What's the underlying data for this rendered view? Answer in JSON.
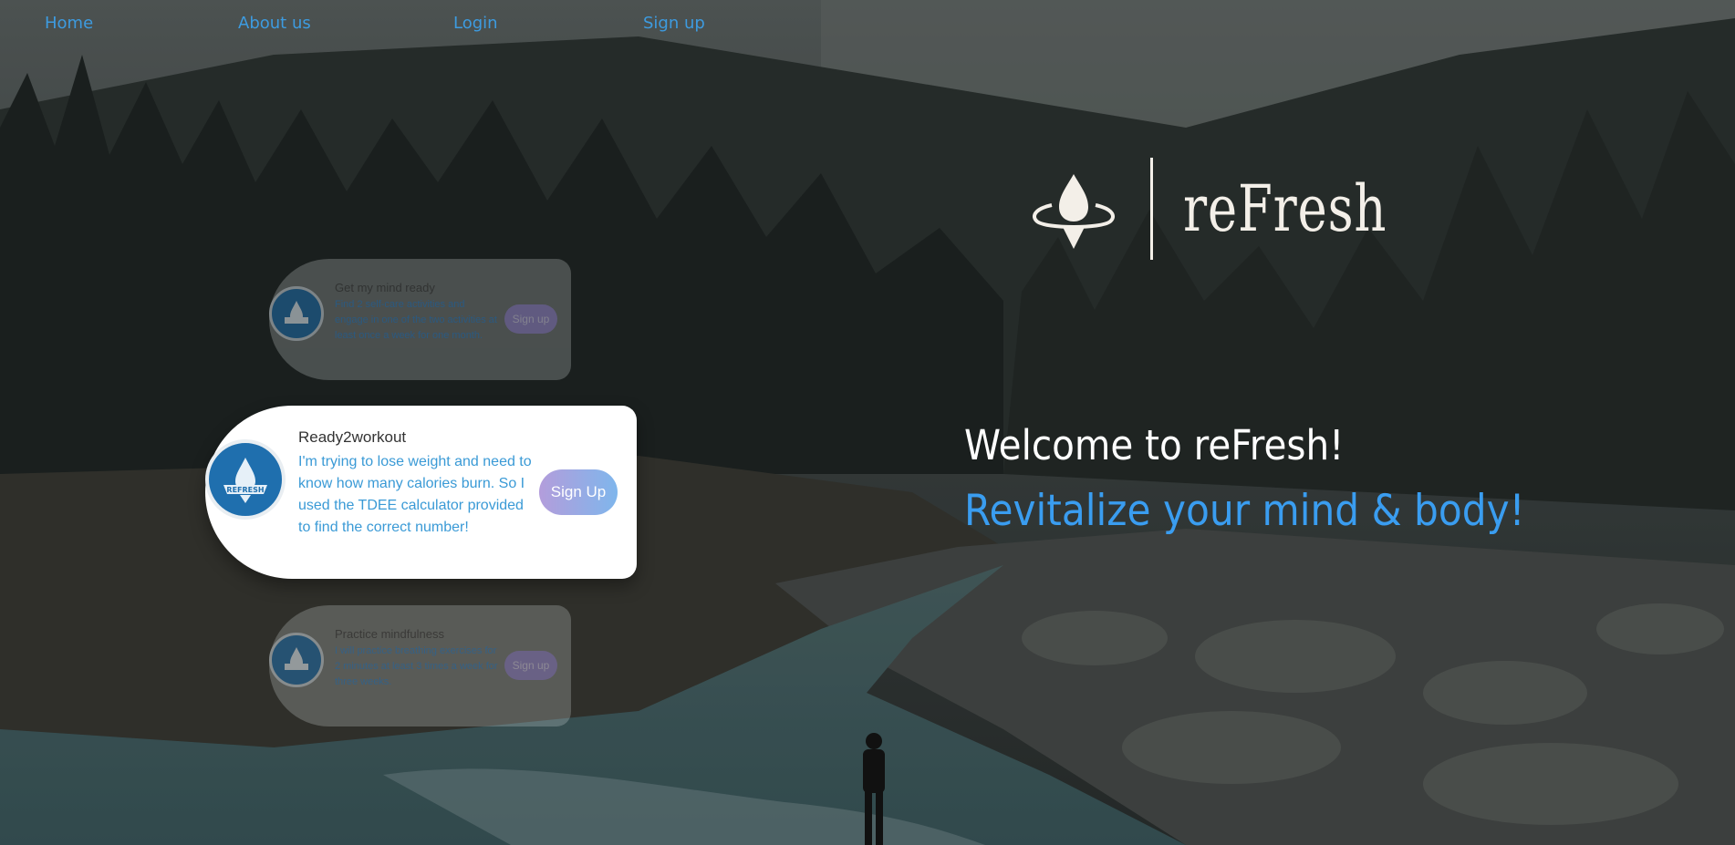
{
  "nav": {
    "items": [
      "Home",
      "About us",
      "Login",
      "Sign up"
    ]
  },
  "brand": {
    "name": "reFresh",
    "badge_text": "REFRESH"
  },
  "hero": {
    "welcome": "Welcome to reFresh!",
    "tagline": "Revitalize your mind & body!"
  },
  "cards": [
    {
      "title": "Get my mind ready",
      "text": "Find 2 self-care activities and engage in one of the two activities at least once a week for one month.",
      "button": "Sign up"
    },
    {
      "title": "Ready2workout",
      "text": "I'm trying to lose weight and need to know how many calories burn. So I used the TDEE calculator provided to find the correct number!",
      "button": "Sign Up"
    },
    {
      "title": "Practice mindfulness",
      "text": "I will practice breathing exercises for 2 minutes at least 3 times a week for three weeks.",
      "button": "Sign up"
    }
  ],
  "colors": {
    "nav_link": "#3d9be0",
    "tagline": "#3a9df0",
    "avatar": "#1f6fae",
    "button_gradient_start": "#b39ddb",
    "button_gradient_end": "#7fb6ec"
  },
  "icons": {
    "logo": "water-drop-ripple-icon",
    "avatar": "refresh-badge-icon"
  }
}
